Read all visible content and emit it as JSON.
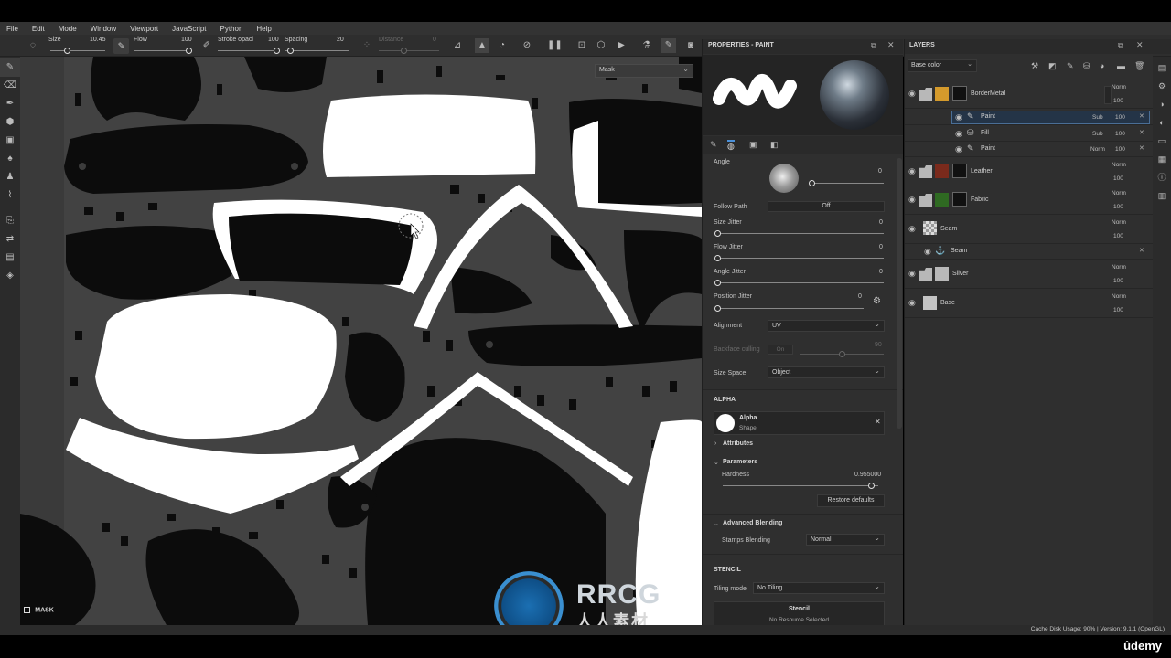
{
  "menu": [
    "File",
    "Edit",
    "Mode",
    "Window",
    "Viewport",
    "JavaScript",
    "Python",
    "Help"
  ],
  "toolbar": {
    "size_label": "Size",
    "size_value": "10.45",
    "flow_label": "Flow",
    "flow_value": "100",
    "stroke_label": "Stroke opaci",
    "stroke_value": "100",
    "spacing_label": "Spacing",
    "spacing_value": "20",
    "distance_label": "Distance",
    "distance_value": "0",
    "mask_label": "Mask"
  },
  "viewport": {
    "mask_label": "MASK"
  },
  "properties": {
    "title": "PROPERTIES - PAINT",
    "angle_label": "Angle",
    "angle_value": "0",
    "follow_path_label": "Follow Path",
    "follow_path_value": "Off",
    "size_jitter_label": "Size Jitter",
    "size_jitter_value": "0",
    "flow_jitter_label": "Flow Jitter",
    "flow_jitter_value": "0",
    "angle_jitter_label": "Angle Jitter",
    "angle_jitter_value": "0",
    "position_jitter_label": "Position Jitter",
    "position_jitter_value": "0",
    "alignment_label": "Alignment",
    "alignment_value": "UV",
    "backface_label": "Backface culling",
    "backface_value": "On",
    "backface_num": "90",
    "size_space_label": "Size Space",
    "size_space_value": "Object",
    "alpha_header": "ALPHA",
    "alpha_name": "Alpha",
    "alpha_type": "Shape",
    "attributes_label": "Attributes",
    "parameters_label": "Parameters",
    "hardness_label": "Hardness",
    "hardness_value": "0.955000",
    "hardness_fraction": 0.955,
    "restore_label": "Restore defaults",
    "adv_blending_label": "Advanced Blending",
    "stamps_blending_label": "Stamps Blending",
    "stamps_blending_value": "Normal",
    "stencil_header": "STENCIL",
    "tiling_label": "Tiling mode",
    "tiling_value": "No Tiling",
    "stencil_title": "Stencil",
    "stencil_status": "No Resource Selected"
  },
  "layers": {
    "title": "LAYERS",
    "channel": "Base color",
    "items": [
      {
        "name": "BorderMetal",
        "mode": "Norm",
        "opacity": "100",
        "color": "#d49a2c"
      },
      {
        "name": "Paint",
        "mode": "Sub",
        "opacity": "100"
      },
      {
        "name": "Fill",
        "mode": "Sub",
        "opacity": "100"
      },
      {
        "name": "Paint",
        "mode": "Norm",
        "opacity": "100"
      },
      {
        "name": "Leather",
        "mode": "Norm",
        "opacity": "100",
        "color": "#7a2a1c"
      },
      {
        "name": "Fabric",
        "mode": "Norm",
        "opacity": "100",
        "color": "#2f6a22"
      },
      {
        "name": "Seam",
        "mode": "Norm",
        "opacity": "100"
      },
      {
        "name": "Seam"
      },
      {
        "name": "Silver",
        "mode": "Norm",
        "opacity": "100",
        "color": "#b8b8b8"
      },
      {
        "name": "Base",
        "mode": "Norm",
        "opacity": "100",
        "color": "#c4c4c4"
      }
    ]
  },
  "status": {
    "text": "Cache Disk Usage:  90% | Version: 9.1.1 (OpenGL)"
  },
  "watermark": {
    "brand": "RRCG",
    "sub": "人人素材",
    "udemy": "ûdemy"
  }
}
